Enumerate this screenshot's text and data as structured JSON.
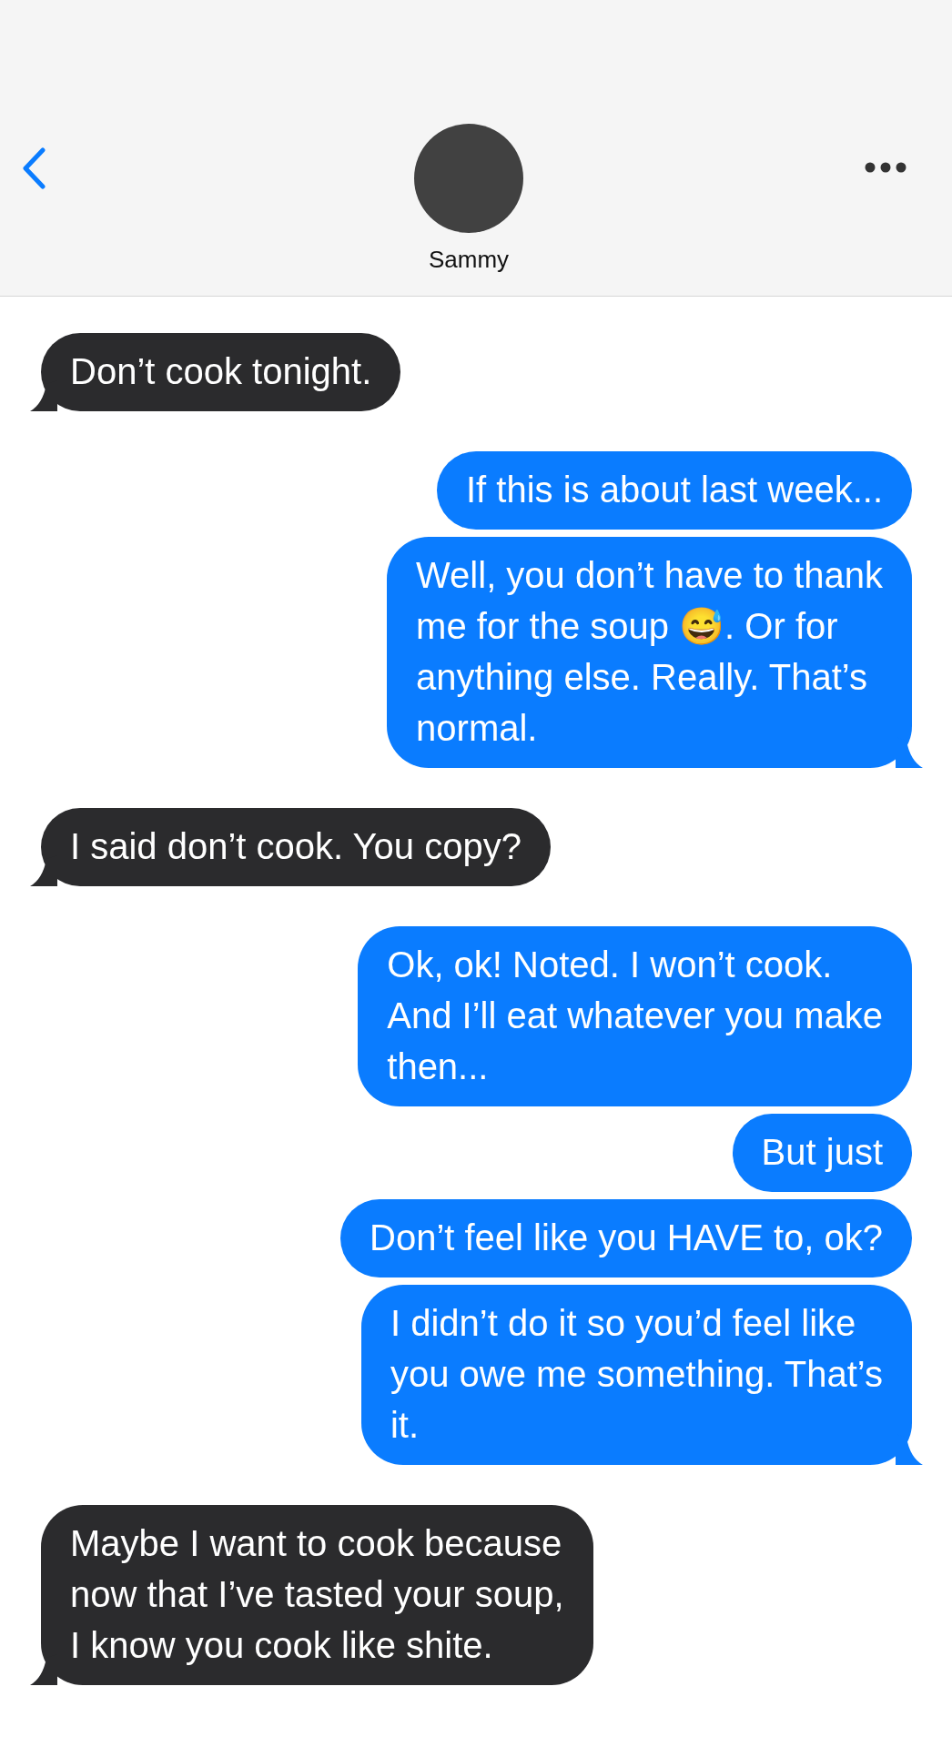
{
  "header": {
    "contact": {
      "name": "Sammy"
    }
  },
  "messages": [
    {
      "kind": "incoming",
      "text": "Don’t cook tonight.",
      "tail": true
    },
    {
      "kind": "outgoing",
      "text": "If this is about last week...",
      "tail": false
    },
    {
      "kind": "outgoing",
      "text": "Well, you don’t have to thank\nme for the soup 😅. Or for\nanything else. Really. That’s\nnormal.",
      "tail": true
    },
    {
      "kind": "incoming",
      "text": "I said don’t cook. You copy?",
      "tail": true
    },
    {
      "kind": "outgoing",
      "text": "Ok, ok! Noted. I won’t cook.\nAnd I’ll eat whatever you make\nthen...",
      "tail": false
    },
    {
      "kind": "outgoing",
      "text": "But just",
      "tail": false
    },
    {
      "kind": "outgoing",
      "text": "Don’t feel like you HAVE to, ok?",
      "tail": false
    },
    {
      "kind": "outgoing",
      "text": "I didn’t do it so you’d feel like\nyou owe me something. That’s\nit.",
      "tail": true
    },
    {
      "kind": "incoming",
      "text": "Maybe I want to cook because\nnow that I’ve tasted your soup,\nI know you cook like shite.",
      "tail": true
    }
  ]
}
